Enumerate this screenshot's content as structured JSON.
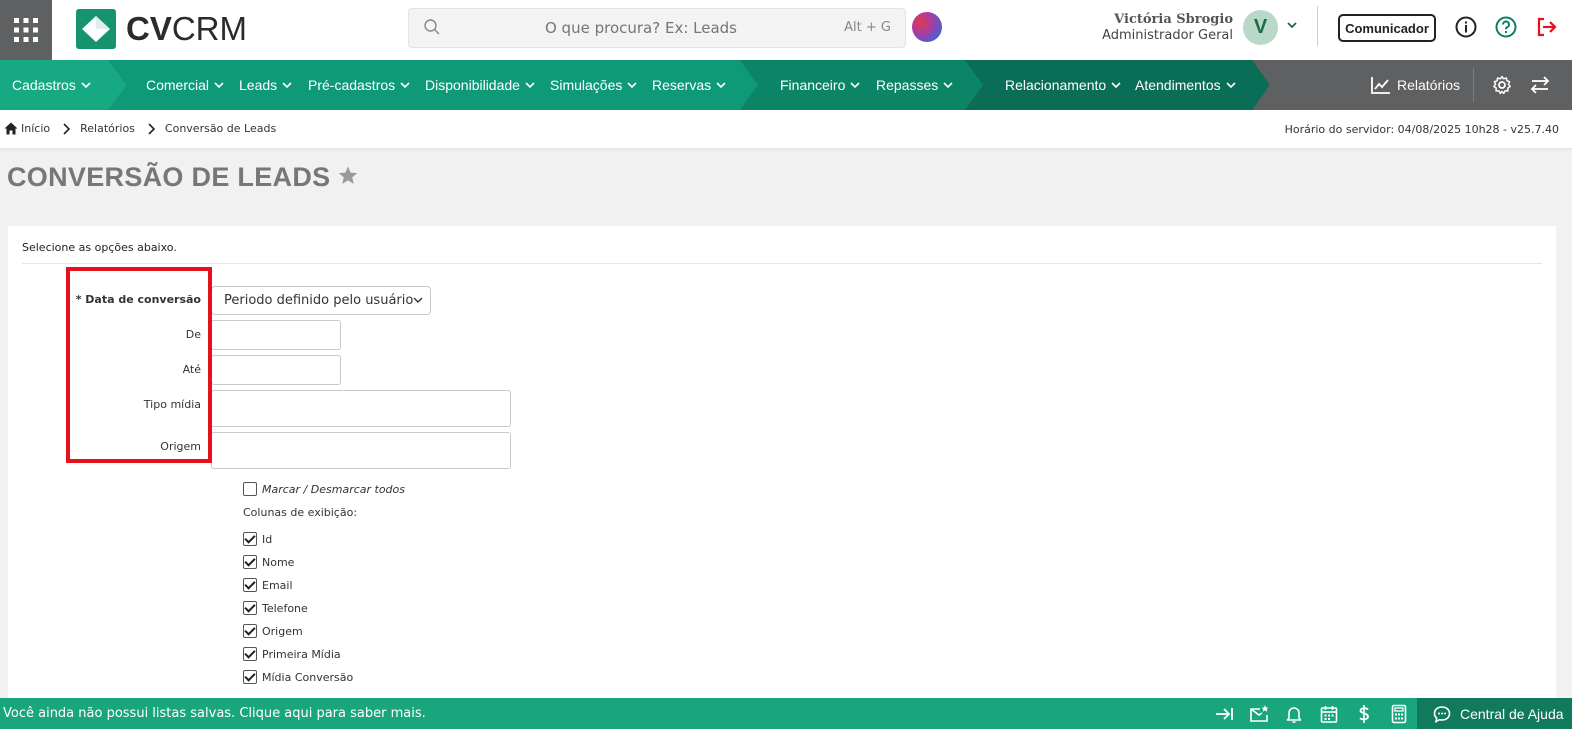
{
  "header": {
    "logo_text_bold": "CV",
    "logo_text_light": "CRM",
    "search_placeholder": "O que procura? Ex: Leads",
    "search_shortcut": "Alt + G",
    "user_name": "Victória Sbrogio",
    "user_role": "Administrador Geral",
    "avatar_letter": "V",
    "comunicador_label": "Comunicador"
  },
  "nav": {
    "items": [
      {
        "label": "Cadastros"
      },
      {
        "label": "Comercial"
      },
      {
        "label": "Leads"
      },
      {
        "label": "Pré-cadastros"
      },
      {
        "label": "Disponibilidade"
      },
      {
        "label": "Simulações"
      },
      {
        "label": "Reservas"
      },
      {
        "label": "Financeiro"
      },
      {
        "label": "Repasses"
      },
      {
        "label": "Relacionamento"
      },
      {
        "label": "Atendimentos"
      }
    ],
    "reports_label": "Relatórios",
    "colors": {
      "teal_light": "#16a982",
      "teal_mid": "#0e8f6e",
      "teal_dark": "#0b6e57",
      "gray": "#5f6062"
    }
  },
  "breadcrumb": {
    "items": [
      "Início",
      "Relatórios",
      "Conversão de Leads"
    ],
    "server_time": "Horário do servidor: 04/08/2025 10h28 - v25.7.40"
  },
  "page": {
    "title": "CONVERSÃO DE LEADS"
  },
  "form": {
    "intro": "Selecione as opções abaixo.",
    "data_conversao_label": "* Data de conversão",
    "data_conversao_value": "Periodo definido pelo usuário",
    "de_label": "De",
    "ate_label": "Até",
    "tipo_midia_label": "Tipo mídia",
    "origem_label": "Origem",
    "marcar_label": "Marcar / Desmarcar todos",
    "colunas_label": "Colunas de exibição:",
    "columns": [
      {
        "label": "Id",
        "checked": true
      },
      {
        "label": "Nome",
        "checked": true
      },
      {
        "label": "Email",
        "checked": true
      },
      {
        "label": "Telefone",
        "checked": true
      },
      {
        "label": "Origem",
        "checked": true
      },
      {
        "label": "Primeira Mídia",
        "checked": true
      },
      {
        "label": "Mídia Conversão",
        "checked": true
      }
    ]
  },
  "footer": {
    "message": "Você ainda não possui listas salvas. Clique aqui para saber mais.",
    "help_label": "Central de Ajuda"
  }
}
